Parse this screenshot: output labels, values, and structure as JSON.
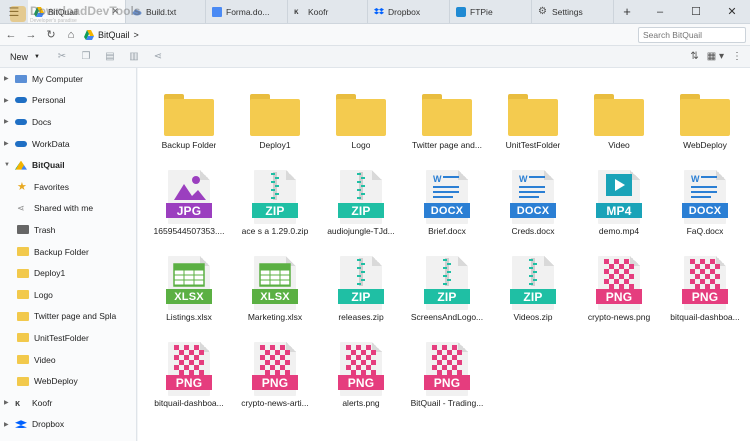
{
  "tabs": [
    {
      "label": "BitQuail",
      "active": true,
      "icon": "gdrive-icon"
    },
    {
      "label": "Build.txt",
      "icon": "cloud-icon"
    },
    {
      "label": "Forma.do...",
      "icon": "gdoc-icon"
    },
    {
      "label": "Koofr",
      "icon": "koofr-icon"
    },
    {
      "label": "Dropbox",
      "icon": "dropbox-icon"
    },
    {
      "label": "FTPie",
      "icon": "ftp-icon"
    },
    {
      "label": "Settings",
      "icon": "gear-icon"
    }
  ],
  "window_controls": {
    "new_tab": "+",
    "minimize": "–",
    "maximize": "☐",
    "close": "✕"
  },
  "address": {
    "crumb": "BitQuail",
    "separator": ">",
    "search_placeholder": "Search BitQuail"
  },
  "toolbar": {
    "new_label": "New"
  },
  "sidebar": [
    {
      "label": "My Computer",
      "icon": "monitor-icon",
      "level": 0,
      "arrow": "▶"
    },
    {
      "label": "Personal",
      "icon": "onedrive-icon",
      "level": 0,
      "arrow": "▶"
    },
    {
      "label": "Docs",
      "icon": "onedrive-icon",
      "level": 0,
      "arrow": "▶"
    },
    {
      "label": "WorkData",
      "icon": "onedrive-icon",
      "level": 0,
      "arrow": "▶"
    },
    {
      "label": "BitQuail",
      "icon": "gdrive-icon",
      "level": 0,
      "arrow": "▼",
      "bold": true
    },
    {
      "label": "Favorites",
      "icon": "star-icon",
      "level": 1
    },
    {
      "label": "Shared with me",
      "icon": "share-icon",
      "level": 1
    },
    {
      "label": "Trash",
      "icon": "trash-icon",
      "level": 1
    },
    {
      "label": "Backup Folder",
      "icon": "folder-icon",
      "level": 1
    },
    {
      "label": "Deploy1",
      "icon": "folder-icon",
      "level": 1
    },
    {
      "label": "Logo",
      "icon": "folder-icon",
      "level": 1
    },
    {
      "label": "Twitter page and Spla",
      "icon": "folder-icon",
      "level": 1
    },
    {
      "label": "UnitTestFolder",
      "icon": "folder-icon",
      "level": 1
    },
    {
      "label": "Video",
      "icon": "folder-icon",
      "level": 1
    },
    {
      "label": "WebDeploy",
      "icon": "folder-icon",
      "level": 1
    },
    {
      "label": "Koofr",
      "icon": "koofr-icon",
      "level": 0,
      "arrow": "▶"
    },
    {
      "label": "Dropbox",
      "icon": "dropbox-icon",
      "level": 0,
      "arrow": "▶"
    }
  ],
  "files": [
    {
      "name": "Backup Folder",
      "kind": "folder"
    },
    {
      "name": "Deploy1",
      "kind": "folder"
    },
    {
      "name": "Logo",
      "kind": "folder"
    },
    {
      "name": "Twitter page and...",
      "kind": "folder"
    },
    {
      "name": "UnitTestFolder",
      "kind": "folder"
    },
    {
      "name": "Video",
      "kind": "folder"
    },
    {
      "name": "WebDeploy",
      "kind": "folder"
    },
    {
      "name": "1659544507353....",
      "kind": "file",
      "type": "JPG",
      "color": "#9b3fbf",
      "art": "image"
    },
    {
      "name": "ace s a 1.29.0.zip",
      "kind": "file",
      "type": "ZIP",
      "color": "#1fbfa4",
      "art": "zip"
    },
    {
      "name": "audiojungle-TJd...",
      "kind": "file",
      "type": "ZIP",
      "color": "#1fbfa4",
      "art": "zip"
    },
    {
      "name": "Brief.docx",
      "kind": "file",
      "type": "DOCX",
      "color": "#2b7fd4",
      "art": "doc"
    },
    {
      "name": "Creds.docx",
      "kind": "file",
      "type": "DOCX",
      "color": "#2b7fd4",
      "art": "doc"
    },
    {
      "name": "demo.mp4",
      "kind": "file",
      "type": "MP4",
      "color": "#1aa3b8",
      "art": "video"
    },
    {
      "name": "FaQ.docx",
      "kind": "file",
      "type": "DOCX",
      "color": "#2b7fd4",
      "art": "doc"
    },
    {
      "name": "Listings.xlsx",
      "kind": "file",
      "type": "XLSX",
      "color": "#5bb043",
      "art": "sheet"
    },
    {
      "name": "Marketing.xlsx",
      "kind": "file",
      "type": "XLSX",
      "color": "#5bb043",
      "art": "sheet"
    },
    {
      "name": "releases.zip",
      "kind": "file",
      "type": "ZIP",
      "color": "#1fbfa4",
      "art": "zip"
    },
    {
      "name": "ScreensAndLogo...",
      "kind": "file",
      "type": "ZIP",
      "color": "#1fbfa4",
      "art": "zip"
    },
    {
      "name": "Videos.zip",
      "kind": "file",
      "type": "ZIP",
      "color": "#1fbfa4",
      "art": "zip"
    },
    {
      "name": "crypto-news.png",
      "kind": "file",
      "type": "PNG",
      "color": "#e53d7e",
      "art": "checker"
    },
    {
      "name": "bitquail-dashboa...",
      "kind": "file",
      "type": "PNG",
      "color": "#e53d7e",
      "art": "checker"
    },
    {
      "name": "bitquail-dashboa...",
      "kind": "file",
      "type": "PNG",
      "color": "#e53d7e",
      "art": "checker"
    },
    {
      "name": "crypto-news-arti...",
      "kind": "file",
      "type": "PNG",
      "color": "#e53d7e",
      "art": "checker"
    },
    {
      "name": "alerts.png",
      "kind": "file",
      "type": "PNG",
      "color": "#e53d7e",
      "art": "checker"
    },
    {
      "name": "BitQuail - Trading...",
      "kind": "file",
      "type": "PNG",
      "color": "#e53d7e",
      "art": "checker"
    }
  ],
  "watermark": {
    "title": "DownloadDevTools",
    "subtitle": "Developer's paradise"
  }
}
